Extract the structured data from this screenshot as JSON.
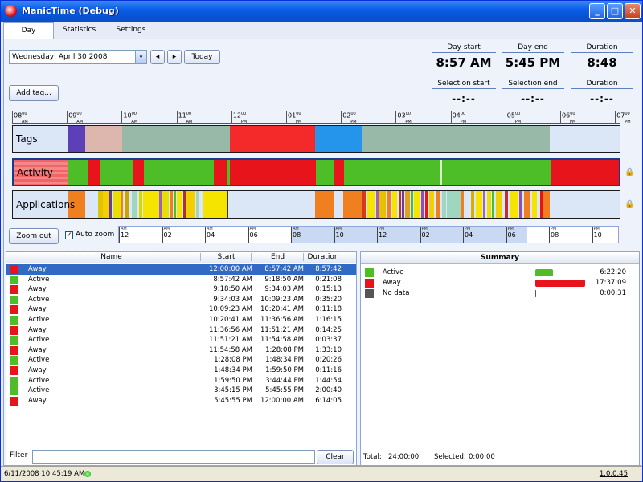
{
  "window": {
    "title": "ManicTime (Debug)",
    "min": "_",
    "max": "□",
    "close": "✕"
  },
  "tabs": [
    "Day",
    "Statistics",
    "Settings"
  ],
  "toolbar": {
    "date": "Wednesday, April 30 2008",
    "prev": "◂",
    "next": "▸",
    "today": "Today",
    "add_tag": "Add tag...",
    "zoom_out": "Zoom out",
    "auto_zoom": "Auto zoom",
    "auto_zoom_checked": true,
    "dropdown": "▾"
  },
  "stats": {
    "day_start_label": "Day start",
    "day_start": "8:57 AM",
    "day_end_label": "Day end",
    "day_end": "5:45 PM",
    "duration_label": "Duration",
    "duration": "8:48",
    "sel_start_label": "Selection start",
    "sel_start": "--:--",
    "sel_end_label": "Selection end",
    "sel_end": "--:--",
    "sel_duration_label": "Duration",
    "sel_duration": "--:--"
  },
  "timeline": {
    "ruler": [
      {
        "h": "08",
        "m": "00",
        "ap": "AM"
      },
      {
        "h": "09",
        "m": "00",
        "ap": "AM"
      },
      {
        "h": "10",
        "m": "00",
        "ap": "AM"
      },
      {
        "h": "11",
        "m": "00",
        "ap": "AM"
      },
      {
        "h": "12",
        "m": "00",
        "ap": "PM"
      },
      {
        "h": "01",
        "m": "00",
        "ap": "PM"
      },
      {
        "h": "02",
        "m": "00",
        "ap": "PM"
      },
      {
        "h": "03",
        "m": "00",
        "ap": "PM"
      },
      {
        "h": "04",
        "m": "00",
        "ap": "PM"
      },
      {
        "h": "05",
        "m": "00",
        "ap": "PM"
      },
      {
        "h": "06",
        "m": "00",
        "ap": "PM"
      },
      {
        "h": "07",
        "m": "00",
        "ap": "PM"
      }
    ],
    "rows": [
      "Tags",
      "Activity",
      "Applications"
    ],
    "lock_icon": "🔒"
  },
  "zoom_ruler": [
    {
      "ap": "AM",
      "h": "12"
    },
    {
      "ap": "AM",
      "h": "02"
    },
    {
      "ap": "AM",
      "h": "04"
    },
    {
      "ap": "AM",
      "h": "06"
    },
    {
      "ap": "AM",
      "h": "08"
    },
    {
      "ap": "AM",
      "h": "10"
    },
    {
      "ap": "PM",
      "h": "12"
    },
    {
      "ap": "PM",
      "h": "02"
    },
    {
      "ap": "PM",
      "h": "04"
    },
    {
      "ap": "PM",
      "h": "06"
    },
    {
      "ap": "PM",
      "h": "08"
    },
    {
      "ap": "PM",
      "h": "10"
    }
  ],
  "activity_list": {
    "headers": {
      "name": "Name",
      "start": "Start",
      "end": "End",
      "duration": "Duration"
    },
    "rows": [
      {
        "name": "Away",
        "start": "12:00:00 AM",
        "end": "8:57:42 AM",
        "duration": "8:57:42",
        "color": "#e8141b",
        "selected": true
      },
      {
        "name": "Active",
        "start": "8:57:42 AM",
        "end": "9:18:50 AM",
        "duration": "0:21:08",
        "color": "#4dbd28"
      },
      {
        "name": "Away",
        "start": "9:18:50 AM",
        "end": "9:34:03 AM",
        "duration": "0:15:13",
        "color": "#e8141b"
      },
      {
        "name": "Active",
        "start": "9:34:03 AM",
        "end": "10:09:23 AM",
        "duration": "0:35:20",
        "color": "#4dbd28"
      },
      {
        "name": "Away",
        "start": "10:09:23 AM",
        "end": "10:20:41 AM",
        "duration": "0:11:18",
        "color": "#e8141b"
      },
      {
        "name": "Active",
        "start": "10:20:41 AM",
        "end": "11:36:56 AM",
        "duration": "1:16:15",
        "color": "#4dbd28"
      },
      {
        "name": "Away",
        "start": "11:36:56 AM",
        "end": "11:51:21 AM",
        "duration": "0:14:25",
        "color": "#e8141b"
      },
      {
        "name": "Active",
        "start": "11:51:21 AM",
        "end": "11:54:58 AM",
        "duration": "0:03:37",
        "color": "#4dbd28"
      },
      {
        "name": "Away",
        "start": "11:54:58 AM",
        "end": "1:28:08 PM",
        "duration": "1:33:10",
        "color": "#e8141b"
      },
      {
        "name": "Active",
        "start": "1:28:08 PM",
        "end": "1:48:34 PM",
        "duration": "0:20:26",
        "color": "#4dbd28"
      },
      {
        "name": "Away",
        "start": "1:48:34 PM",
        "end": "1:59:50 PM",
        "duration": "0:11:16",
        "color": "#e8141b"
      },
      {
        "name": "Active",
        "start": "1:59:50 PM",
        "end": "3:44:44 PM",
        "duration": "1:44:54",
        "color": "#4dbd28"
      },
      {
        "name": "Active",
        "start": "3:45:15 PM",
        "end": "5:45:55 PM",
        "duration": "2:00:40",
        "color": "#4dbd28"
      },
      {
        "name": "Away",
        "start": "5:45:55 PM",
        "end": "12:00:00 AM",
        "duration": "6:14:05",
        "color": "#e8141b"
      }
    ]
  },
  "filter": {
    "label": "Filter",
    "value": "",
    "clear": "Clear"
  },
  "summary": {
    "title": "Summary",
    "rows": [
      {
        "name": "Active",
        "value": "6:22:20",
        "color": "#4dbd28",
        "fraction": 0.265
      },
      {
        "name": "Away",
        "value": "17:37:09",
        "color": "#e8141b",
        "fraction": 0.734
      },
      {
        "name": "No data",
        "value": "0:00:31",
        "color": "#555555",
        "fraction": 0.0004
      }
    ],
    "total_label": "Total:",
    "total": "24:00:00",
    "selected_label": "Selected:",
    "selected": "0:00:00"
  },
  "status": {
    "datetime": "6/11/2008 10:45:19 AM",
    "version": "1.0.0.45"
  }
}
